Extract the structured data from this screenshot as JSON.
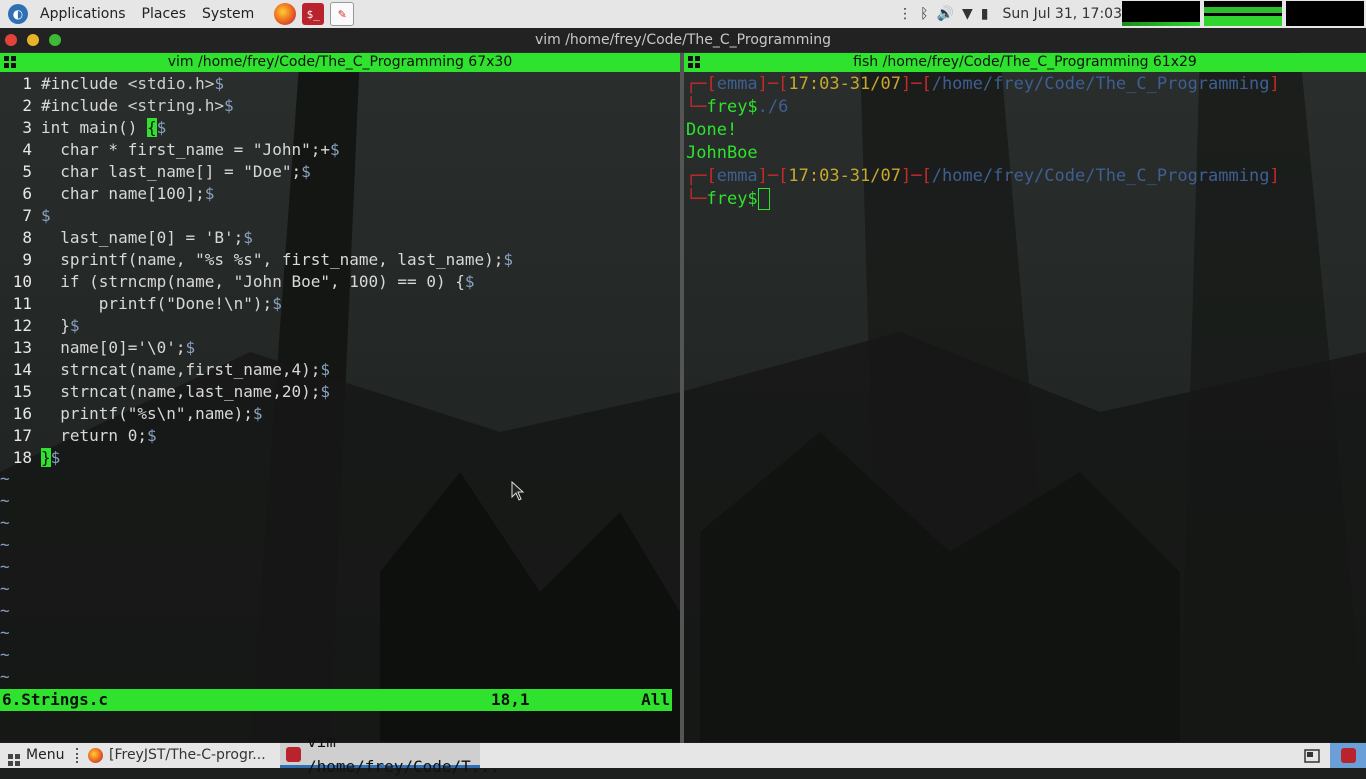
{
  "top_panel": {
    "menus": [
      "Applications",
      "Places",
      "System"
    ],
    "clock": "Sun Jul 31, 17:03"
  },
  "window": {
    "title": "vim /home/frey/Code/The_C_Programming"
  },
  "panes": {
    "left_title": "vim /home/frey/Code/The_C_Programming 67x30",
    "right_title": "fish /home/frey/Code/The_C_Programming 61x29"
  },
  "vim": {
    "lines": [
      {
        "n": "1",
        "pre": "#include ",
        "code": "<stdio.h>",
        "post": "",
        "eol": "$"
      },
      {
        "n": "2",
        "pre": "#include ",
        "code": "<string.h>",
        "post": "",
        "eol": "$"
      },
      {
        "n": "3",
        "pre": "int main() ",
        "code": "{",
        "post": "",
        "eol": "$"
      },
      {
        "n": "4",
        "pre": "  char * first_name = \"John\";+",
        "code": "",
        "post": "",
        "eol": "$"
      },
      {
        "n": "5",
        "pre": "  char last_name[] = \"Doe\";",
        "code": "",
        "post": "",
        "eol": "$"
      },
      {
        "n": "6",
        "pre": "  char name[100];",
        "code": "",
        "post": "",
        "eol": "$"
      },
      {
        "n": "7",
        "pre": "",
        "code": "",
        "post": "",
        "eol": "$"
      },
      {
        "n": "8",
        "pre": "  last_name[0] = 'B';",
        "code": "",
        "post": "",
        "eol": "$"
      },
      {
        "n": "9",
        "pre": "  sprintf(name, \"%s %s\", first_name, last_name);",
        "code": "",
        "post": "",
        "eol": "$"
      },
      {
        "n": "10",
        "pre": "  if (strncmp(name, \"John Boe\", 100) == 0) {",
        "code": "",
        "post": "",
        "eol": "$"
      },
      {
        "n": "11",
        "pre": "      printf(\"Done!\\n\");",
        "code": "",
        "post": "",
        "eol": "$"
      },
      {
        "n": "12",
        "pre": "  }",
        "code": "",
        "post": "",
        "eol": "$"
      },
      {
        "n": "13",
        "pre": "  name[0]='\\0';",
        "code": "",
        "post": "",
        "eol": "$"
      },
      {
        "n": "14",
        "pre": "  strncat(name,first_name,4);",
        "code": "",
        "post": "",
        "eol": "$"
      },
      {
        "n": "15",
        "pre": "  strncat(name,last_name,20);",
        "code": "",
        "post": "",
        "eol": "$"
      },
      {
        "n": "16",
        "pre": "  printf(\"%s\\n\",name);",
        "code": "",
        "post": "",
        "eol": "$"
      },
      {
        "n": "17",
        "pre": "  return 0;",
        "code": "",
        "post": "",
        "eol": "$"
      },
      {
        "n": "18",
        "pre": "",
        "code": "}",
        "post": "",
        "eol": "$"
      }
    ],
    "tilde": "~",
    "tilde_count": 10,
    "status": {
      "file": "6.Strings.c",
      "position": "18,1",
      "scroll": "All"
    }
  },
  "fish": {
    "prompt_user": "emma",
    "prompt_time": "17:03-31/07",
    "prompt_path": "/home/frey/Code/The_C_Programming",
    "prompt_name": "frey$",
    "command": "./6",
    "output": [
      "Done!",
      "JohnBoe"
    ]
  },
  "taskbar": {
    "menu_label": "Menu",
    "tasks": [
      {
        "label": "[FreyJST/The-C-progr..."
      },
      {
        "label": "vim /home/frey/Code/T..."
      }
    ]
  },
  "colors": {
    "accent_green": "#2ee22e",
    "prompt_red": "#c82a2a",
    "prompt_blue": "#3f5f92",
    "prompt_yellow": "#c8a82a"
  }
}
